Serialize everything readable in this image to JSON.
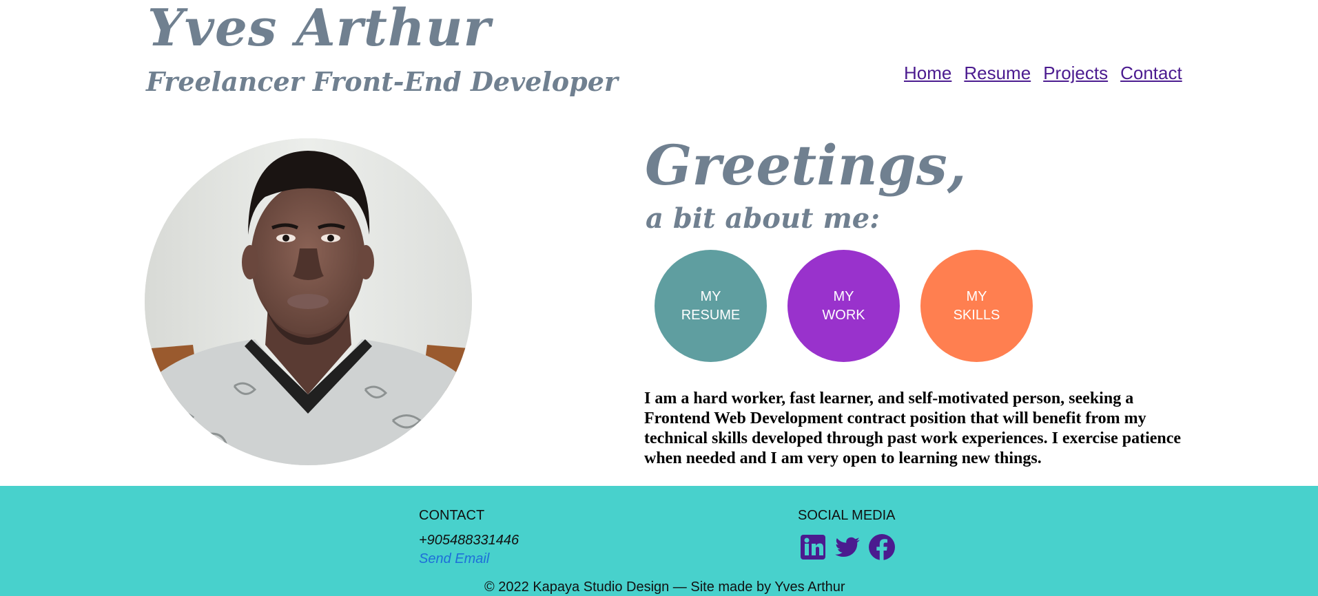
{
  "header": {
    "name": "Yves Arthur",
    "subtitle": "Freelancer Front-End Developer",
    "nav": [
      {
        "label": "Home"
      },
      {
        "label": "Resume"
      },
      {
        "label": "Projects"
      },
      {
        "label": "Contact"
      }
    ]
  },
  "intro": {
    "greeting": "Greetings,",
    "subheading": "a bit about me:",
    "buttons": [
      {
        "line1": "MY",
        "line2": "RESUME",
        "color": "#5f9ea0"
      },
      {
        "line1": "MY",
        "line2": "WORK",
        "color": "#9932cc"
      },
      {
        "line1": "MY",
        "line2": "SKILLS",
        "color": "#ff7f50"
      }
    ],
    "about": "I am a hard worker, fast learner, and self-motivated person, seeking a Frontend Web Development contract position that will benefit from my technical skills developed through past work experiences. I exercise patience when needed and I am very open to learning new things."
  },
  "footer": {
    "contact_heading": "CONTACT",
    "phone": "+905488331446",
    "email_label": "Send Email",
    "social_heading": "SOCIAL MEDIA",
    "social_icons": [
      "linkedin-icon",
      "twitter-icon",
      "facebook-icon"
    ],
    "copyright": "© 2022 Kapaya Studio Design — Site made by Yves Arthur"
  },
  "colors": {
    "heading_gray": "#708090",
    "nav_link": "#4b1b8f",
    "footer_bg": "#48d1cc",
    "social_icon": "#4b1b8f",
    "email_link": "#1e6fd9"
  }
}
